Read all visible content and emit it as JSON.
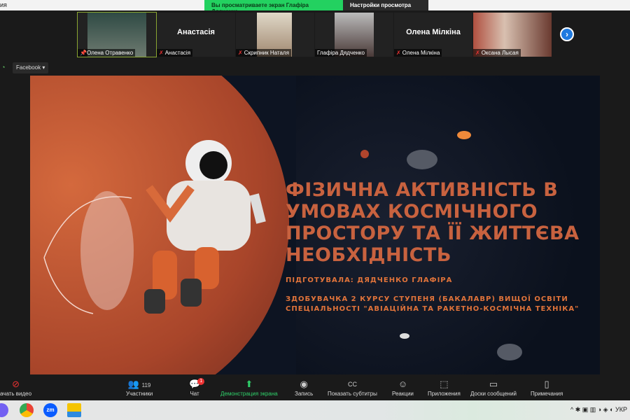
{
  "topbar": {
    "left_text": "ия",
    "banner": "Вы просматриваете экран Глафіра Дядченко",
    "view_settings": "Настройки просмотра",
    "chevron": "⌄"
  },
  "participants": [
    {
      "name": "Олена Отравенко",
      "pinned": true,
      "video": true,
      "color": "#3d5a50"
    },
    {
      "name": "Анастасія",
      "muted": true,
      "video": false,
      "big": "Анастасія"
    },
    {
      "name": "Скрипник Наталя",
      "muted": true,
      "video": true,
      "color": "#c9b9a0"
    },
    {
      "name": "Глафіра Дядченко",
      "video": true,
      "color": "#6a5a55"
    },
    {
      "name": "Олена Мілкіна",
      "muted": true,
      "video": false,
      "big": "Олена Мілкіна"
    },
    {
      "name": "Оксана Лысая",
      "muted": true,
      "video": true,
      "color": "#8a4a3a"
    }
  ],
  "next_icon": "›",
  "facebook": "Facebook ▾",
  "slide": {
    "title": [
      "ФІЗИЧНА АКТИВНІСТЬ В",
      "УМОВАХ КОСМІЧНОГО",
      "ПРОСТОРУ ТА ЇЇ ЖИТТЄВА",
      "НЕОБХІДНІСТЬ"
    ],
    "author": "ПІДГОТУВАЛА: ДЯДЧЕНКО ГЛАФІРА",
    "desc1": "ЗДОБУВАЧКА 2 КУРСУ СТУПЕНЯ (БАКАЛАВР) ВИЩОЇ ОСВІТИ",
    "desc2": "СПЕЦІАЛЬНОСТІ \"АВІАЦІЙНА ТА РАКЕТНО-КОСМІЧНА ТЕХНІКА\""
  },
  "toolbar": {
    "video": "ачать видео",
    "participants": "Участники",
    "participants_count": "119",
    "chat": "Чат",
    "chat_badge": "1",
    "share": "Демонстрация экрана",
    "record": "Запись",
    "captions": "Показать субтитры",
    "reactions": "Реакции",
    "apps": "Приложения",
    "whiteboards": "Доски сообщений",
    "notes": "Примечания"
  },
  "taskbar": {
    "zoom": "zm",
    "tray": "^ ✱ ▣ ▥ ◑ ◈ ◐ УКР"
  },
  "colors": {
    "banner": "#23d160",
    "title": "#c8623f",
    "subtitle": "#e0733a",
    "share": "#2fd06a"
  }
}
